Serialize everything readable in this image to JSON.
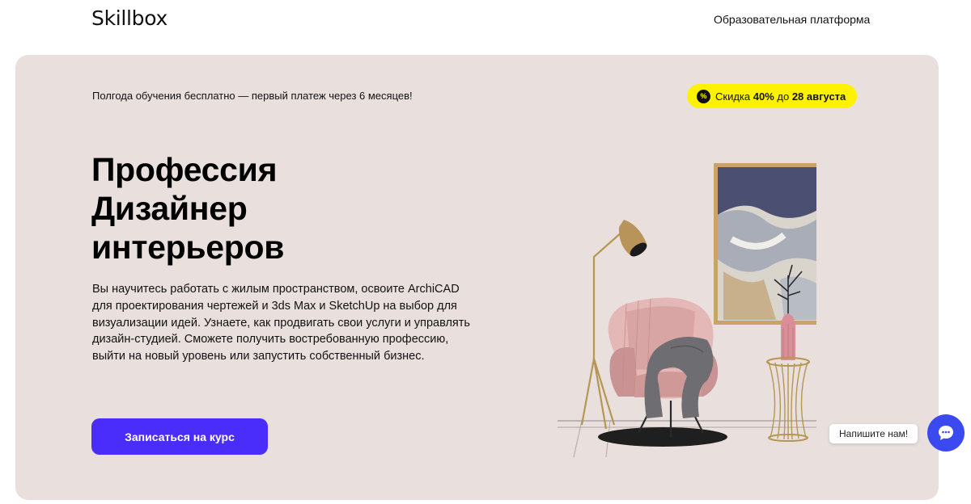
{
  "header": {
    "logo": "Skillbox",
    "nav_link": "Образовательная платформа"
  },
  "hero": {
    "promo_text": "Полгода обучения бесплатно — первый платеж через 6 месяцев!",
    "discount": {
      "icon": "percent-icon",
      "prefix": "Скидка ",
      "percent": "40%",
      "middle": " до ",
      "date": "28 августа",
      "color": "#fff200"
    },
    "title_lines": [
      "Профессия",
      "Дизайнер",
      "интерьеров"
    ],
    "description": "Вы научитесь работать с жилым пространством, освоите ArchiCAD для проектирования чертежей и 3ds Max и SketchUp на выбор для визуализации идей. Узнаете, как продвигать свои услуги и управлять дизайн-студией. Сможете получить востребованную профессию, выйти на новый уровень или запустить собственный бизнес.",
    "cta_label": "Записаться на курс",
    "cta_color": "#4a2cfb",
    "background": "#e9e0dd"
  },
  "chat": {
    "tooltip": "Напишите нам!",
    "icon": "chat-bubble-icon",
    "color": "#3a49f0"
  }
}
